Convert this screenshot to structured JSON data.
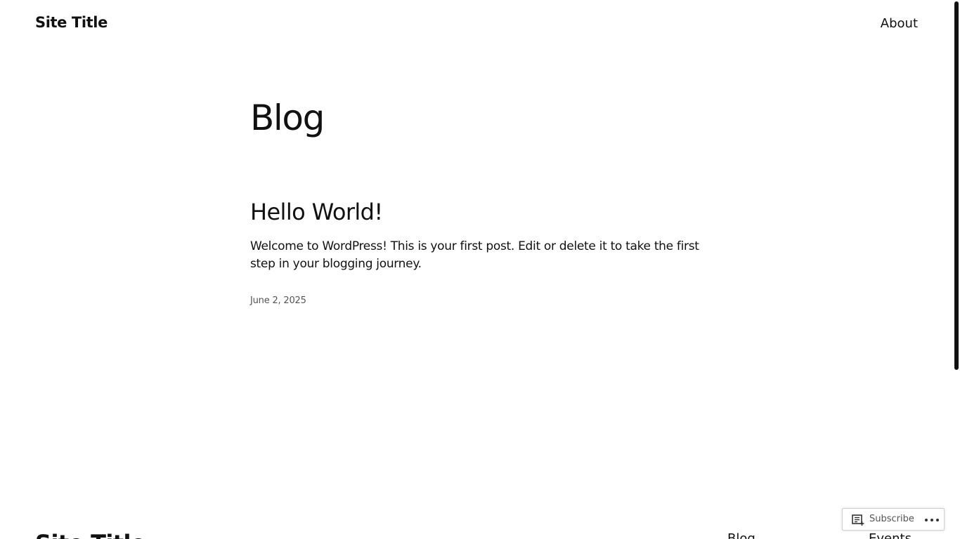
{
  "header": {
    "site_title": "Site Title",
    "nav": {
      "about_label": "About"
    }
  },
  "main": {
    "heading": "Blog",
    "posts": [
      {
        "title": "Hello World!",
        "excerpt": "Welcome to WordPress! This is your first post. Edit or delete it to take the first step in your blogging journey.",
        "date": "June 2, 2025"
      }
    ]
  },
  "footer": {
    "site_title": "Site Title",
    "links": [
      {
        "label": "Blog"
      },
      {
        "label": "Events"
      }
    ]
  },
  "subscribe_bar": {
    "subscribe_label": "Subscribe",
    "reader_icon": "reader-icon",
    "more_icon": "ellipsis-icon"
  }
}
